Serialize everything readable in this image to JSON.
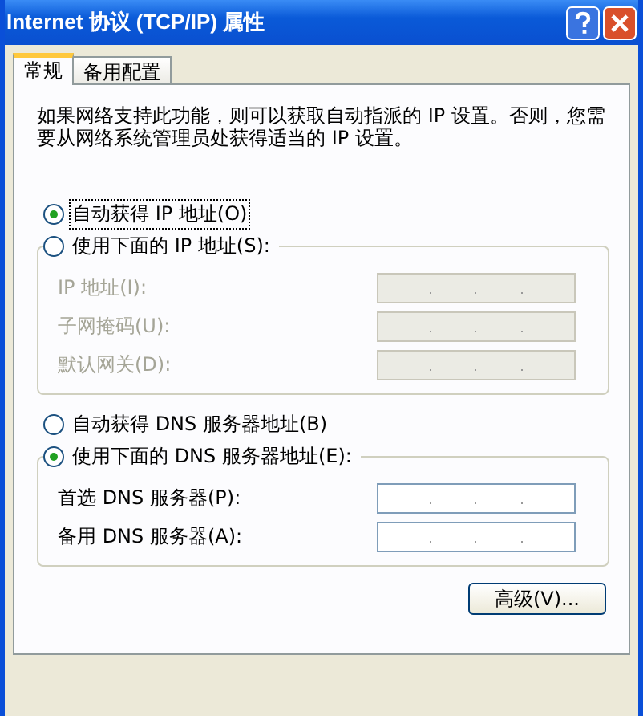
{
  "window": {
    "title": "Internet 协议 (TCP/IP) 属性"
  },
  "tabs": [
    {
      "label": "常规",
      "selected": true
    },
    {
      "label": "备用配置",
      "selected": false
    }
  ],
  "description": "如果网络支持此功能，则可以获取自动指派的 IP 设置。否则，您需要从网络系统管理员处获得适当的 IP 设置。",
  "sections": [
    {
      "auto_option": {
        "label": "自动获得 IP 地址(O)",
        "selected": true,
        "focused": true
      },
      "manual_option": {
        "label": "使用下面的 IP 地址(S):",
        "selected": false
      },
      "fields": [
        {
          "label": "IP 地址(I):",
          "disabled": true
        },
        {
          "label": "子网掩码(U):",
          "disabled": true
        },
        {
          "label": "默认网关(D):",
          "disabled": true
        }
      ]
    },
    {
      "auto_option": {
        "label": "自动获得 DNS 服务器地址(B)",
        "selected": false,
        "focused": false
      },
      "manual_option": {
        "label": "使用下面的 DNS 服务器地址(E):",
        "selected": true
      },
      "fields": [
        {
          "label": "首选 DNS 服务器(P):",
          "disabled": false
        },
        {
          "label": "备用 DNS 服务器(A):",
          "disabled": false
        }
      ]
    }
  ],
  "advanced_button": "高级(V)..."
}
